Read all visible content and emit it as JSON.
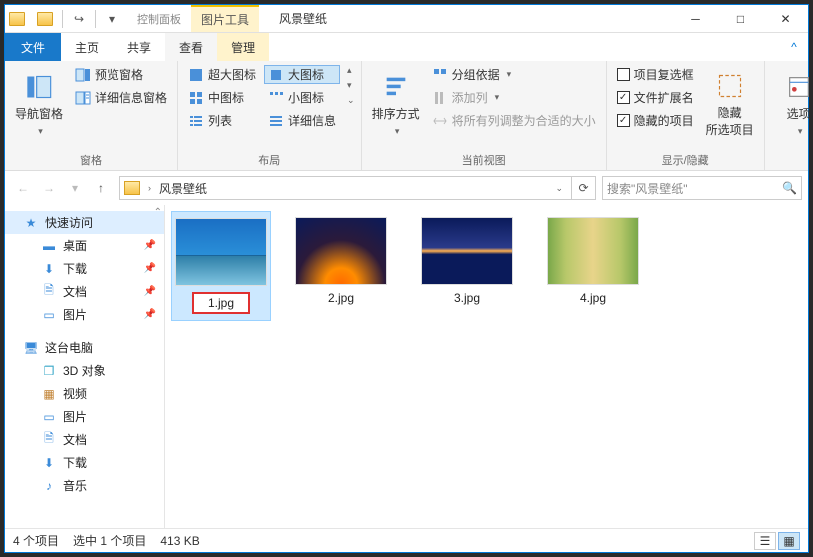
{
  "titlebar": {
    "context_tab_top": "图片工具",
    "window_title": "风景壁纸"
  },
  "menubar": {
    "file": "文件",
    "home": "主页",
    "share": "共享",
    "view": "查看",
    "context": "管理"
  },
  "topbanner": "控制面板",
  "ribbon": {
    "panes": {
      "nav_pane": "导航窗格",
      "preview_pane": "预览窗格",
      "details_pane": "详细信息窗格",
      "group": "窗格"
    },
    "layout": {
      "extra_large": "超大图标",
      "large": "大图标",
      "medium": "中图标",
      "small": "小图标",
      "list": "列表",
      "details": "详细信息",
      "group": "布局"
    },
    "currentview": {
      "sort": "排序方式",
      "group_by": "分组依据",
      "add_columns": "添加列",
      "size_all": "将所有列调整为合适的大小",
      "group": "当前视图"
    },
    "showhide": {
      "item_check": "项目复选框",
      "file_ext": "文件扩展名",
      "hidden": "隐藏的项目",
      "hide_selected": "隐藏\n所选项目",
      "group": "显示/隐藏"
    },
    "options": "选项"
  },
  "address": {
    "crumb": "风景壁纸",
    "search_placeholder": "搜索\"风景壁纸\""
  },
  "tree": {
    "quick_access": "快速访问",
    "desktop": "桌面",
    "downloads": "下载",
    "documents": "文档",
    "pictures": "图片",
    "this_pc": "这台电脑",
    "objects_3d": "3D 对象",
    "videos": "视频",
    "pictures2": "图片",
    "documents2": "文档",
    "downloads2": "下载",
    "music": "音乐"
  },
  "files": {
    "f1": "1.jpg",
    "f2": "2.jpg",
    "f3": "3.jpg",
    "f4": "4.jpg"
  },
  "status": {
    "count": "4 个项目",
    "selected": "选中 1 个项目",
    "size": "413 KB"
  }
}
